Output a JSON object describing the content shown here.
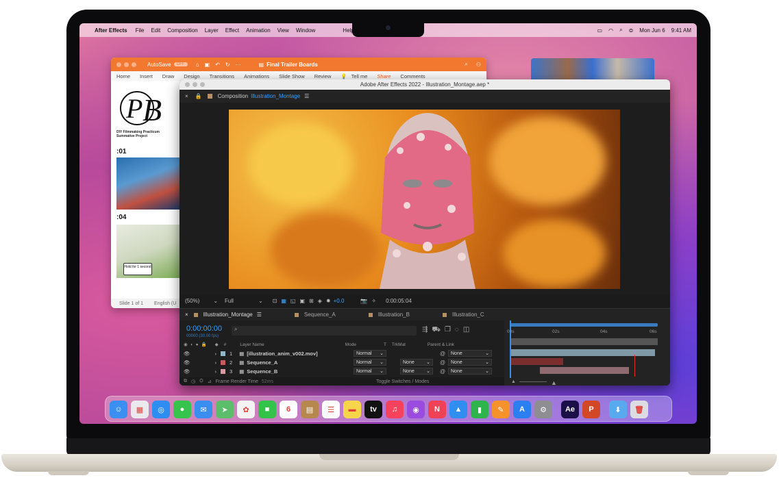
{
  "menubar": {
    "app_name": "After Effects",
    "menus": [
      "File",
      "Edit",
      "Composition",
      "Layer",
      "Effect",
      "Animation",
      "View",
      "Window"
    ],
    "help": "Help",
    "date": "Mon Jun 6",
    "time": "9:41 AM"
  },
  "powerpoint": {
    "autosave": "AutoSave",
    "toggle": "OFF",
    "title": "Final Trailer Boards",
    "ribbon": [
      "Home",
      "Insert",
      "Draw",
      "Design",
      "Transitions",
      "Animations",
      "Slide Show",
      "Review"
    ],
    "tell_me": "Tell me",
    "share": "Share",
    "comments": "Comments",
    "thumb1_caption": "DIY Filmmaking Practicum Summative Project",
    "thumb2_label": ":01",
    "thumb3_label": ":04",
    "thumb3_note": "Hold for 1 second",
    "status_slide": "Slide 1 of 1",
    "status_lang": "English (U"
  },
  "after_effects": {
    "window_title": "Adobe After Effects 2022 - Illustration_Montage.aep *",
    "comp_label": "Composition",
    "comp_name": "Illustration_Montage",
    "zoom": "(50%)",
    "resolution": "Full",
    "exposure": "+0.0",
    "viewer_time": "0:00:05:04",
    "tabs": [
      "Illustration_Montage",
      "Sequence_A",
      "Illustration_B",
      "Illustration_C"
    ],
    "timecode": "0:00:00:00",
    "fps": "00000 (30.00 fps)",
    "columns": {
      "layer_name": "Layer Name",
      "mode": "Mode",
      "t": "T",
      "trkmat": "TrkMat",
      "parent": "Parent & Link"
    },
    "layers": [
      {
        "num": "1",
        "name": "[illustration_anim_v002.mov]",
        "mode": "Normal",
        "trkmat": "",
        "parent": "None",
        "color": "#8fb7c9"
      },
      {
        "num": "2",
        "name": "Sequence_A",
        "mode": "Normal",
        "trkmat": "None",
        "parent": "None",
        "color": "#c75a5a"
      },
      {
        "num": "3",
        "name": "Sequence_B",
        "mode": "Normal",
        "trkmat": "None",
        "parent": "None",
        "color": "#d99aa0"
      }
    ],
    "ruler": [
      "00s",
      "02s",
      "04s",
      "06s"
    ],
    "footer_left": "Frame Render Time",
    "footer_time": "52ms",
    "footer_toggle": "Toggle Switches / Modes"
  },
  "dock": {
    "apps": [
      {
        "name": "finder-icon",
        "color": "#3b8ff0",
        "glyph": "☺"
      },
      {
        "name": "launchpad-icon",
        "color": "#e9e9ee",
        "glyph": "▦"
      },
      {
        "name": "safari-icon",
        "color": "#2d8df0",
        "glyph": "◎"
      },
      {
        "name": "messages-icon",
        "color": "#37c44d",
        "glyph": "●"
      },
      {
        "name": "mail-icon",
        "color": "#3a8ef0",
        "glyph": "✉"
      },
      {
        "name": "maps-icon",
        "color": "#5cbd6a",
        "glyph": "➤"
      },
      {
        "name": "photos-icon",
        "color": "#f3f3f3",
        "glyph": "✿"
      },
      {
        "name": "facetime-icon",
        "color": "#33c24a",
        "glyph": "■"
      },
      {
        "name": "calendar-icon",
        "color": "#ffffff",
        "glyph": "6"
      },
      {
        "name": "notes-brown-icon",
        "color": "#b7884e",
        "glyph": "▤"
      },
      {
        "name": "reminders-icon",
        "color": "#ffffff",
        "glyph": "☰"
      },
      {
        "name": "notes-icon",
        "color": "#f6d54a",
        "glyph": "▬"
      },
      {
        "name": "tv-icon",
        "color": "#111111",
        "glyph": "tv"
      },
      {
        "name": "music-icon",
        "color": "#f6425c",
        "glyph": "♫"
      },
      {
        "name": "podcasts-icon",
        "color": "#9b4ce0",
        "glyph": "◉"
      },
      {
        "name": "news-icon",
        "color": "#f04257",
        "glyph": "N"
      },
      {
        "name": "keynote-icon",
        "color": "#2f8ef0",
        "glyph": "▲"
      },
      {
        "name": "numbers-icon",
        "color": "#2fb34c",
        "glyph": "▮"
      },
      {
        "name": "pages-icon",
        "color": "#f5922c",
        "glyph": "✎"
      },
      {
        "name": "app-store-icon",
        "color": "#2b7ff0",
        "glyph": "A"
      },
      {
        "name": "settings-icon",
        "color": "#8d8d92",
        "glyph": "⚙"
      },
      {
        "name": "after-effects-icon",
        "color": "#1b0f47",
        "glyph": "Ae"
      },
      {
        "name": "powerpoint-icon",
        "color": "#d24726",
        "glyph": "P"
      },
      {
        "name": "downloads-folder-icon",
        "color": "#59a9ef",
        "glyph": "⬇"
      },
      {
        "name": "trash-icon",
        "color": "#dcdce2",
        "glyph": "🗑"
      }
    ]
  }
}
